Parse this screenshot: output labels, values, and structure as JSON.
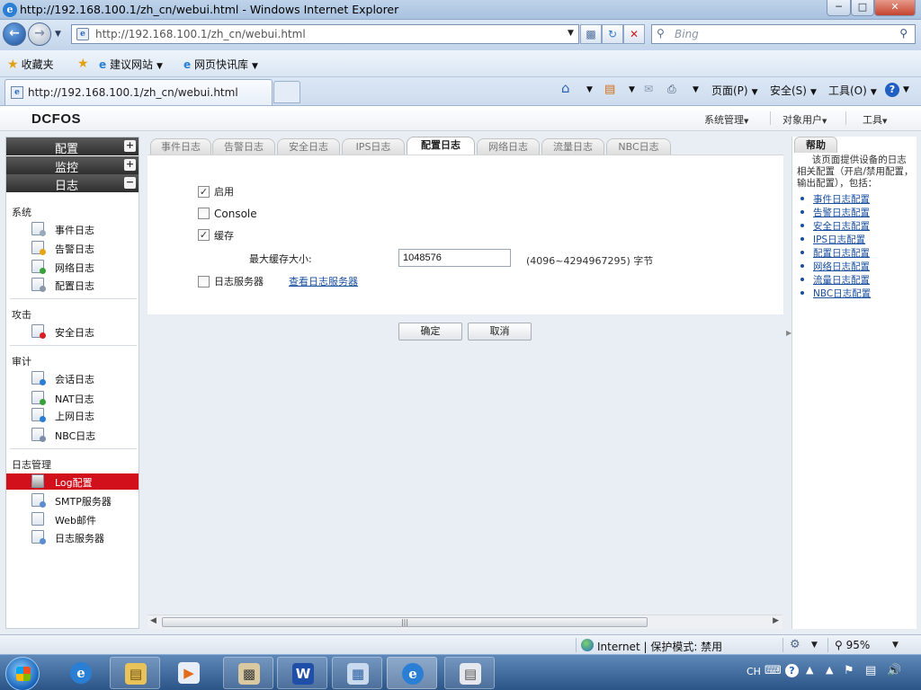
{
  "window": {
    "title": "http://192.168.100.1/zh_cn/webui.html - Windows Internet Explorer"
  },
  "addressbar": {
    "url": "http://192.168.100.1/zh_cn/webui.html",
    "search_placeholder": "Bing"
  },
  "favorites": {
    "favorites_label": "收藏夹",
    "suggested_label": "建议网站",
    "webslice_label": "网页快讯库"
  },
  "tab": {
    "title": "http://192.168.100.1/zh_cn/webui.html"
  },
  "commandbar": {
    "page": "页面(P)",
    "safety": "安全(S)",
    "tools": "工具(O)"
  },
  "app": {
    "logo": "DCFOS",
    "header_menus": [
      "系统管理",
      "对象用户",
      "工具"
    ]
  },
  "sidebar": {
    "sections": [
      "配置",
      "监控",
      "日志"
    ],
    "groups": {
      "system": "系统",
      "attack": "攻击",
      "audit": "审计",
      "logmgmt": "日志管理"
    },
    "items": {
      "event_log": "事件日志",
      "alarm_log": "告警日志",
      "network_log": "网络日志",
      "config_log": "配置日志",
      "security_log": "安全日志",
      "session_log": "会话日志",
      "nat_log": "NAT日志",
      "internet_log": "上网日志",
      "nbc_log": "NBC日志",
      "log_config": "Log配置",
      "smtp_server": "SMTP服务器",
      "web_mail": "Web邮件",
      "log_server": "日志服务器"
    }
  },
  "content": {
    "tabs": [
      "事件日志",
      "告警日志",
      "安全日志",
      "IPS日志",
      "配置日志",
      "网络日志",
      "流量日志",
      "NBC日志"
    ],
    "active_tab": "配置日志",
    "form": {
      "enable_label": "启用",
      "enable_checked": true,
      "console_label": "Console",
      "console_checked": false,
      "buffer_label": "缓存",
      "buffer_checked": true,
      "max_buffer_label": "最大缓存大小:",
      "max_buffer_value": "1048576",
      "max_buffer_range": "(4096~4294967295) 字节",
      "log_server_label": "日志服务器",
      "log_server_checked": false,
      "view_log_server_link": "查看日志服务器"
    },
    "ok_button": "确定",
    "cancel_button": "取消"
  },
  "help": {
    "tab_label": "帮助",
    "text": "该页面提供设备的日志相关配置（开启/禁用配置，输出配置），包括：",
    "links": [
      "事件日志配置",
      "告警日志配置",
      "安全日志配置",
      "IPS日志配置",
      "配置日志配置",
      "网络日志配置",
      "流量日志配置",
      "NBC日志配置"
    ]
  },
  "statusbar": {
    "zone": "Internet | 保护模式: 禁用",
    "zoom": "95%"
  },
  "taskbar": {
    "language": "CH"
  }
}
